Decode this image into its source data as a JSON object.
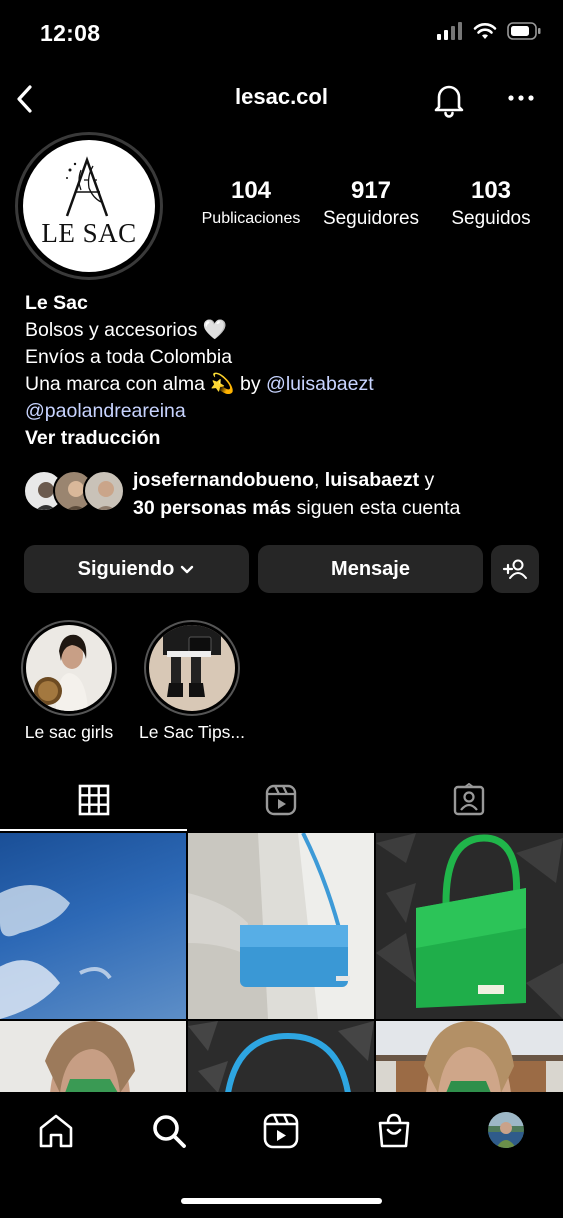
{
  "status_bar": {
    "time": "12:08"
  },
  "header": {
    "username": "lesac.col"
  },
  "profile": {
    "logo_text": "LE SAC",
    "stats": [
      {
        "value": "104",
        "label": "Publicaciones"
      },
      {
        "value": "917",
        "label": "Seguidores"
      },
      {
        "value": "103",
        "label": "Seguidos"
      }
    ],
    "name": "Le Sac",
    "bio_lines": [
      "Bolsos y accesorios 🤍",
      "Envíos a toda Colombia"
    ],
    "bio_brand_prefix": "Una marca con alma 💫 by ",
    "bio_mention_1": "@luisabaezt",
    "bio_mention_2": "@paolandreareina",
    "translate": "Ver traducción"
  },
  "followed_by": {
    "user1": "josefernandobueno",
    "sep": ", ",
    "user2": "luisabaezt",
    "and": " y",
    "others": "30 personas más",
    "suffix": " siguen esta cuenta"
  },
  "actions": {
    "following": "Siguiendo",
    "message": "Mensaje"
  },
  "highlights": [
    {
      "label": "Le sac girls"
    },
    {
      "label": "Le Sac Tips..."
    }
  ],
  "colors": {
    "background": "#000000",
    "button": "#262626",
    "link": "#c8d4ff"
  }
}
